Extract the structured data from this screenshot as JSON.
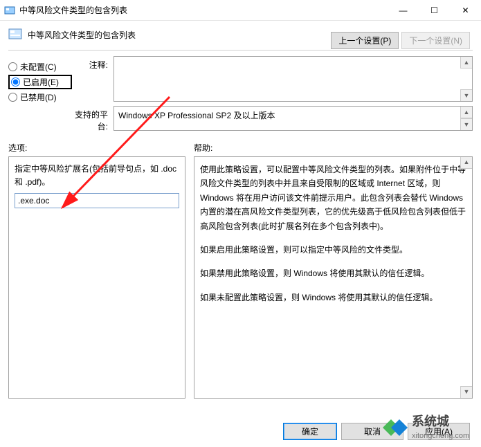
{
  "window": {
    "title": "中等风险文件类型的包含列表",
    "minimize": "—",
    "maximize": "☐",
    "close": "✕"
  },
  "subheader": {
    "title": "中等风险文件类型的包含列表"
  },
  "nav": {
    "prev": "上一个设置(P)",
    "next": "下一个设置(N)"
  },
  "radios": {
    "not_configured": "未配置(C)",
    "enabled": "已启用(E)",
    "disabled": "已禁用(D)"
  },
  "fields": {
    "comment_label": "注释:",
    "comment_value": "",
    "platform_label": "支持的平台:",
    "platform_value": "Windows XP Professional SP2 及以上版本"
  },
  "split": {
    "options_label": "选项:",
    "help_label": "帮助:"
  },
  "options": {
    "desc": "指定中等风险扩展名(包括前导句点，如 .doc 和 .pdf)。",
    "input_value": ".exe.doc"
  },
  "help": {
    "p1": "使用此策略设置，可以配置中等风险文件类型的列表。如果附件位于中等风险文件类型的列表中并且来自受限制的区域或 Internet 区域，则 Windows 将在用户访问该文件前提示用户。此包含列表会替代 Windows 内置的潜在高风险文件类型列表，它的优先级高于低风险包含列表但低于高风险包含列表(此时扩展名列在多个包含列表中)。",
    "p2": "如果启用此策略设置，则可以指定中等风险的文件类型。",
    "p3": "如果禁用此策略设置，则 Windows 将使用其默认的信任逻辑。",
    "p4": "如果未配置此策略设置，则 Windows 将使用其默认的信任逻辑。"
  },
  "footer": {
    "ok": "确定",
    "cancel": "取消",
    "apply": "应用(A)"
  },
  "watermark": {
    "brand": "系统城",
    "url": "xitongcheng.com"
  }
}
